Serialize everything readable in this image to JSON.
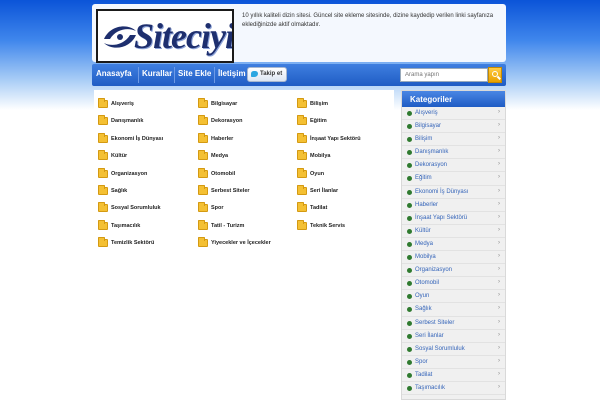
{
  "header": {
    "logo_text": "Siteciyiz",
    "description": "10 yıllık kaliteli dizin sitesi. Güncel site ekleme sitesinde, dizine kaydedip verilen linki sayfanıza eklediğinizde aktif olmaktadır."
  },
  "nav": {
    "items": [
      "Anasayfa",
      "Kurallar",
      "Site Ekle",
      "İletişim"
    ],
    "twitter_label": "Takip et",
    "search_placeholder": "Arama yapın"
  },
  "categories": [
    "Alışveriş",
    "Bilgisayar",
    "Bilişim",
    "Danışmanlık",
    "Dekorasyon",
    "Eğitim",
    "Ekonomi İş Dünyası",
    "Haberler",
    "İnşaat Yapı Sektörü",
    "Kültür",
    "Medya",
    "Mobilya",
    "Organizasyon",
    "Otomobil",
    "Oyun",
    "Sağlık",
    "Serbest Siteler",
    "Seri İlanlar",
    "Sosyal Sorumluluk",
    "Spor",
    "Tadilat",
    "Taşımacılık",
    "Tatil - Turizm",
    "Teknik Servis",
    "Temizlik Sektörü",
    "Yiyecekler ve İçecekler"
  ],
  "sidebar": {
    "title": "Kategoriler",
    "items": [
      "Alışveriş",
      "Bilgisayar",
      "Bilişim",
      "Danışmanlık",
      "Dekorasyon",
      "Eğitim",
      "Ekonomi İş Dünyası",
      "Haberler",
      "İnşaat Yapı Sektörü",
      "Kültür",
      "Medya",
      "Mobilya",
      "Organizasyon",
      "Otomobil",
      "Oyun",
      "Sağlık",
      "Serbest Siteler",
      "Seri İlanlar",
      "Sosyal Sorumluluk",
      "Spor",
      "Tadilat",
      "Taşımacılık"
    ],
    "arrow_glyph": "›"
  },
  "colors": {
    "nav_blue": "#1f5cc4",
    "sidebar_link": "#3464b9",
    "folder": "#f4c033",
    "bullet": "#2f7a2f",
    "search_button": "#e8a000"
  }
}
